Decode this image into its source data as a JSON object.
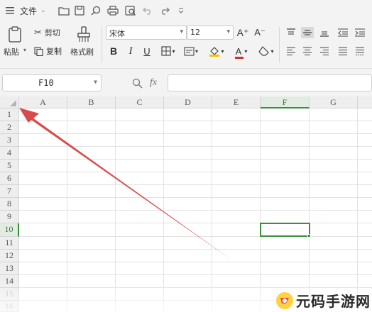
{
  "menubar": {
    "file_label": "文件",
    "icons": [
      "hamburger-icon",
      "open-folder-icon",
      "save-icon",
      "find-icon",
      "print-icon",
      "print-preview-icon",
      "undo-icon",
      "redo-icon",
      "more-icon"
    ]
  },
  "ribbon": {
    "paste_label": "粘贴",
    "cut_label": "剪切",
    "copy_label": "复制",
    "format_painter_label": "格式刷",
    "font_name": "宋体",
    "font_size": "12",
    "font_grow": "A⁺",
    "font_shrink": "A⁻",
    "bold": "B",
    "italic": "I",
    "underline": "U",
    "font_color_letter": "A",
    "colors": {
      "highlight": "#f5c400",
      "font_color": "#d0312d"
    }
  },
  "formula_bar": {
    "name_box": "F10",
    "fx_label": "fx",
    "formula_value": ""
  },
  "sheet": {
    "columns": [
      "A",
      "B",
      "C",
      "D",
      "E",
      "F",
      "G"
    ],
    "rows": [
      "1",
      "2",
      "3",
      "4",
      "5",
      "6",
      "7",
      "8",
      "9",
      "10",
      "11",
      "12",
      "13",
      "14",
      "15",
      "16"
    ],
    "selected_column": "F",
    "selected_row": "10",
    "colors": {
      "selection": "#3a8f3a",
      "arrow": "#d94a4a"
    }
  },
  "watermark": {
    "text": "元码手游网"
  }
}
